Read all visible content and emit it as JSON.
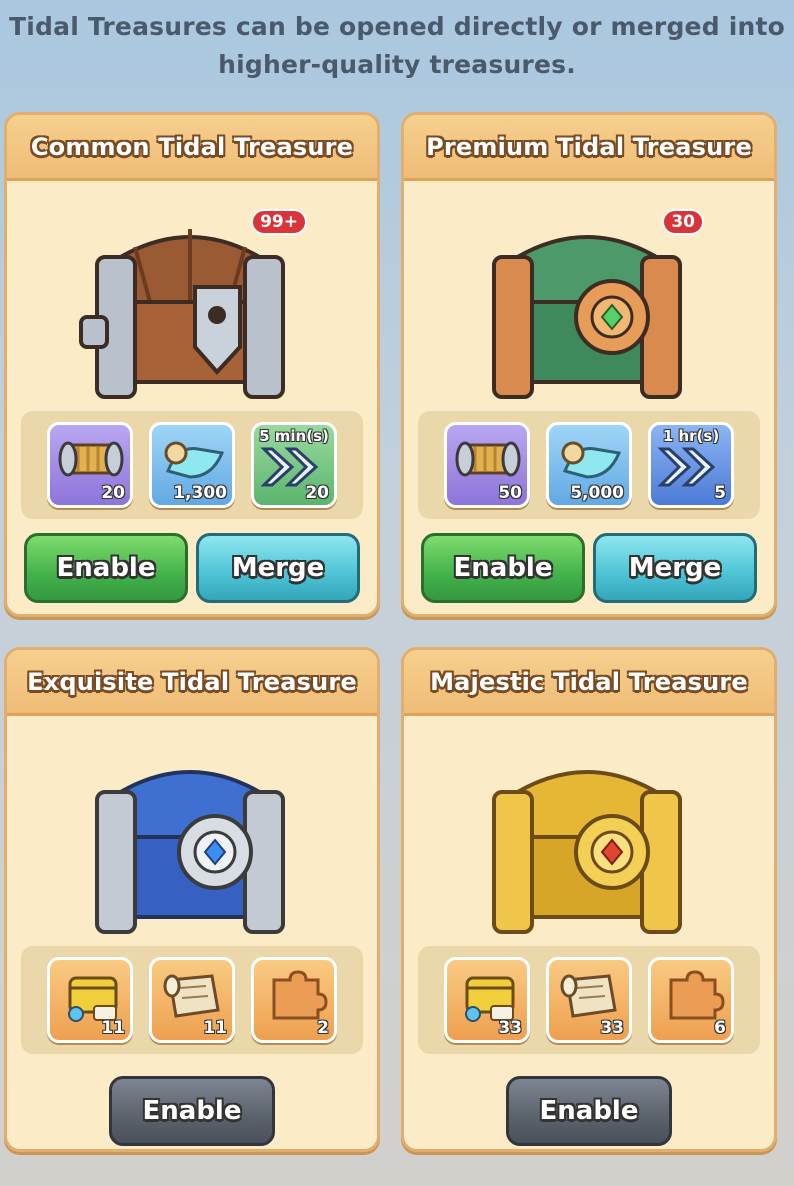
{
  "intro_text": "Tidal Treasures can be opened directly or merged into higher-quality treasures.",
  "cards": [
    {
      "title": "Common Tidal Treasure",
      "count": "99+",
      "chest_color": "silver-wood",
      "rewards": [
        {
          "icon": "thread-spool-icon",
          "qty": "20",
          "bg": "purple"
        },
        {
          "icon": "scroll-icon",
          "qty": "1,300",
          "bg": "blue"
        },
        {
          "icon": "speed-up-icon",
          "qty": "20",
          "time": "5 min(s)",
          "bg": "green"
        }
      ],
      "buttons": [
        "Enable",
        "Merge"
      ]
    },
    {
      "title": "Premium Tidal Treasure",
      "count": "30",
      "chest_color": "bronze-green",
      "rewards": [
        {
          "icon": "thread-spool-icon",
          "qty": "50",
          "bg": "purple"
        },
        {
          "icon": "scroll-icon",
          "qty": "5,000",
          "bg": "blue"
        },
        {
          "icon": "speed-up-icon",
          "qty": "5",
          "time": "1 hr(s)",
          "bg": "navy"
        }
      ],
      "buttons": [
        "Enable",
        "Merge"
      ]
    },
    {
      "title": "Exquisite Tidal Treasure",
      "chest_color": "silver-blue",
      "rewards": [
        {
          "icon": "treasure-pile-icon",
          "qty": "11",
          "bg": "orange"
        },
        {
          "icon": "map-scroll-icon",
          "qty": "11",
          "bg": "orange"
        },
        {
          "icon": "puzzle-piece-icon",
          "qty": "2",
          "bg": "orange"
        }
      ],
      "buttons": [
        "Enable"
      ]
    },
    {
      "title": "Majestic Tidal Treasure",
      "chest_color": "gold",
      "rewards": [
        {
          "icon": "treasure-pile-icon",
          "qty": "33",
          "bg": "orange"
        },
        {
          "icon": "map-scroll-icon",
          "qty": "33",
          "bg": "orange"
        },
        {
          "icon": "puzzle-piece-icon",
          "qty": "6",
          "bg": "orange"
        }
      ],
      "buttons": [
        "Enable"
      ]
    }
  ],
  "colors": {
    "card_bg": "#fbebc6",
    "header_bg": "#eebd77",
    "enable_green": "#43b24b",
    "merge_cyan": "#4cc3d4",
    "enable_gray": "#5a626c",
    "badge_red": "#d8343a"
  }
}
